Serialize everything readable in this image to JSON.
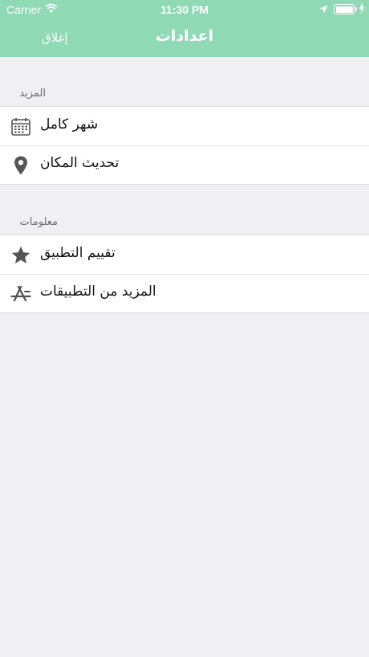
{
  "status_bar": {
    "carrier": "Carrier",
    "time": "11:30 PM"
  },
  "nav": {
    "title": "اعدادات",
    "close_label": "إغلاق"
  },
  "sections": [
    {
      "header": "المزيد",
      "items": [
        {
          "label": "شهر كامل",
          "icon": "calendar-icon"
        },
        {
          "label": "تحديث المكان",
          "icon": "location-pin-icon"
        }
      ]
    },
    {
      "header": "معلومات",
      "items": [
        {
          "label": "تقييم التطبيق",
          "icon": "star-icon"
        },
        {
          "label": "المزيد من التطبيقات",
          "icon": "app-store-icon"
        }
      ]
    }
  ],
  "colors": {
    "accent": "#8fd9b5",
    "background": "#efeff4",
    "cell": "#ffffff",
    "icon": "#555555"
  }
}
